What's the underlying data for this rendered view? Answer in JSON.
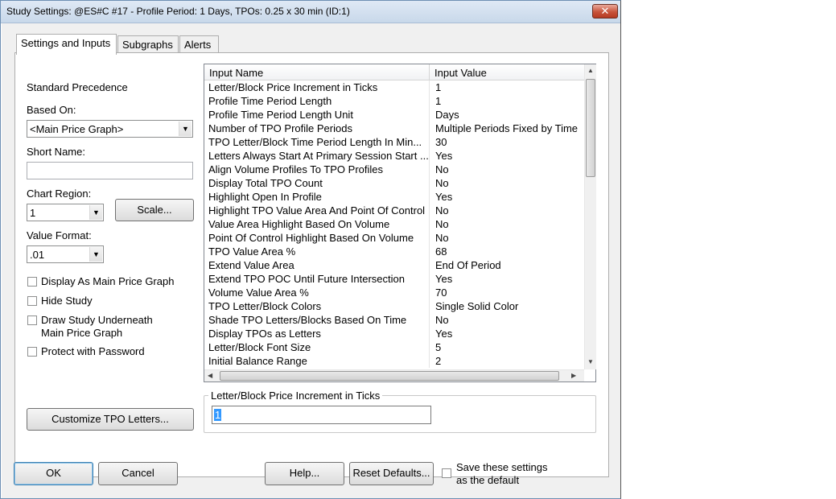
{
  "window": {
    "title": "Study Settings: @ES#C  #17 - Profile Period: 1 Days, TPOs: 0.25 x 30 min   (ID:1)",
    "close_glyph": "✕"
  },
  "tabs": [
    {
      "label": "Settings and Inputs",
      "active": true
    },
    {
      "label": "Subgraphs",
      "active": false
    },
    {
      "label": "Alerts",
      "active": false
    }
  ],
  "left": {
    "standard_precedence": "Standard Precedence",
    "based_on_label": "Based On:",
    "based_on_value": "<Main Price Graph>",
    "short_name_label": "Short Name:",
    "short_name_value": "",
    "chart_region_label": "Chart Region:",
    "chart_region_value": "1",
    "scale_button": "Scale...",
    "value_format_label": "Value Format:",
    "value_format_value": ".01",
    "checkboxes": [
      {
        "label": "Display As Main Price Graph",
        "checked": false
      },
      {
        "label": "Hide Study",
        "checked": false
      },
      {
        "label": "Draw Study Underneath",
        "label2": "Main Price Graph",
        "checked": false
      },
      {
        "label": "Protect with Password",
        "checked": false
      }
    ],
    "customize_button": "Customize TPO Letters..."
  },
  "grid": {
    "col_name": "Input Name",
    "col_value": "Input Value",
    "rows": [
      {
        "name": "Letter/Block Price Increment in Ticks",
        "value": "1"
      },
      {
        "name": "Profile Time Period Length",
        "value": "1"
      },
      {
        "name": "Profile Time Period Length Unit",
        "value": "Days"
      },
      {
        "name": "Number of TPO Profile Periods",
        "value": "Multiple Periods Fixed by Time"
      },
      {
        "name": "TPO Letter/Block Time Period Length In Min...",
        "value": "30"
      },
      {
        "name": "Letters Always Start At Primary Session Start ...",
        "value": "Yes"
      },
      {
        "name": "Align Volume Profiles To TPO Profiles",
        "value": "No"
      },
      {
        "name": "Display Total TPO Count",
        "value": "No"
      },
      {
        "name": "Highlight Open In Profile",
        "value": "Yes"
      },
      {
        "name": "Highlight TPO Value Area And Point Of Control",
        "value": "No"
      },
      {
        "name": "Value Area Highlight Based On Volume",
        "value": "No"
      },
      {
        "name": "Point Of Control Highlight Based On Volume",
        "value": "No"
      },
      {
        "name": "TPO Value Area %",
        "value": "68"
      },
      {
        "name": "Extend Value Area",
        "value": "End Of Period"
      },
      {
        "name": "Extend TPO POC Until Future Intersection",
        "value": "Yes"
      },
      {
        "name": "Volume Value Area %",
        "value": "70"
      },
      {
        "name": "TPO Letter/Block Colors",
        "value": "Single Solid Color"
      },
      {
        "name": "Shade TPO Letters/Blocks Based On Time",
        "value": "No"
      },
      {
        "name": "Display TPOs as Letters",
        "value": "Yes"
      },
      {
        "name": "Letter/Block Font Size",
        "value": "5"
      },
      {
        "name": "Initial Balance Range",
        "value": "2"
      }
    ]
  },
  "description": {
    "label": "Letter/Block Price Increment in Ticks",
    "value": "1"
  },
  "footer": {
    "ok": "OK",
    "cancel": "Cancel",
    "help": "Help...",
    "reset": "Reset Defaults...",
    "save_default_line1": "Save these settings",
    "save_default_line2": "as the default"
  }
}
